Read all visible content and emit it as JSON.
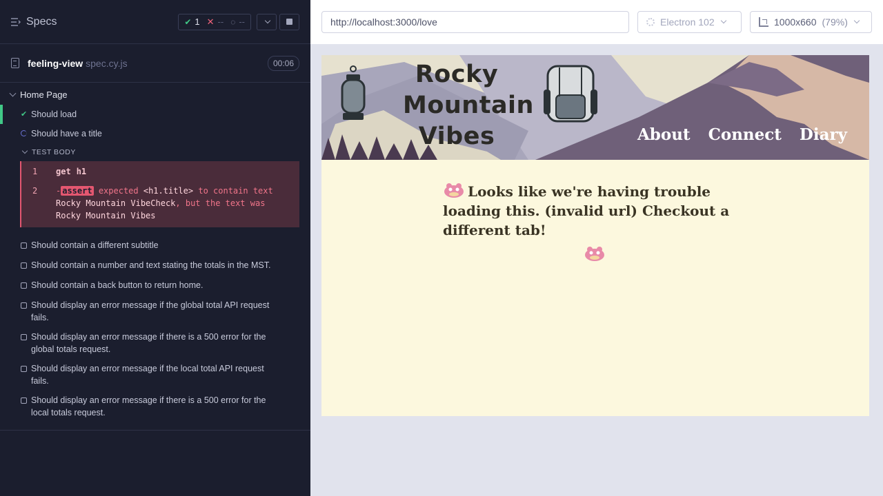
{
  "reporter": {
    "specs_label": "Specs",
    "stats": {
      "passed": "1",
      "failed": "--",
      "pending": "--"
    },
    "spec": {
      "name": "feeling-view",
      "ext": "spec.cy.js",
      "duration": "00:06"
    },
    "suite": "Home Page",
    "tests": {
      "load": "Should load",
      "title": "Should have a title",
      "body_title": "TEST BODY",
      "pending": [
        "Should contain a different subtitle",
        "Should contain a number and text stating the totals in the MST.",
        "Should contain a back button to return home.",
        "Should display an error message if the global total API request fails.",
        "Should display an error message if there is a 500 error for the global totals request.",
        "Should display an error message if the local total API request fails.",
        "Should display an error message if there is a 500 error for the local totals request."
      ]
    },
    "commands": {
      "c1_num": "1",
      "c1_name": "get",
      "c1_sel": "h1",
      "c2_num": "2",
      "c2_dash": "-",
      "c2_tag": "assert",
      "c2_expected": "expected",
      "c2_el": "<h1.title>",
      "c2_contain": "to contain text",
      "c2_text1": "Rocky Mountain VibeCheck",
      "c2_but": ", but the text was",
      "c2_text2": "Rocky Mountain Vibes"
    }
  },
  "aut": {
    "url": "http://localhost:3000/love",
    "browser": "Electron 102",
    "viewport": "1000x660",
    "zoom": "(79%)",
    "site": {
      "logo_lines": [
        "Rocky",
        "Mountain",
        "Vibes"
      ],
      "nav": [
        "About",
        "Connect",
        "Diary"
      ],
      "message": "Looks like we're having trouble loading this. (invalid url) Checkout a different tab!"
    }
  },
  "colors": {
    "pass": "#41c887",
    "fail": "#e45770",
    "running": "#6b72d6",
    "site_bg": "#fcf8de"
  }
}
